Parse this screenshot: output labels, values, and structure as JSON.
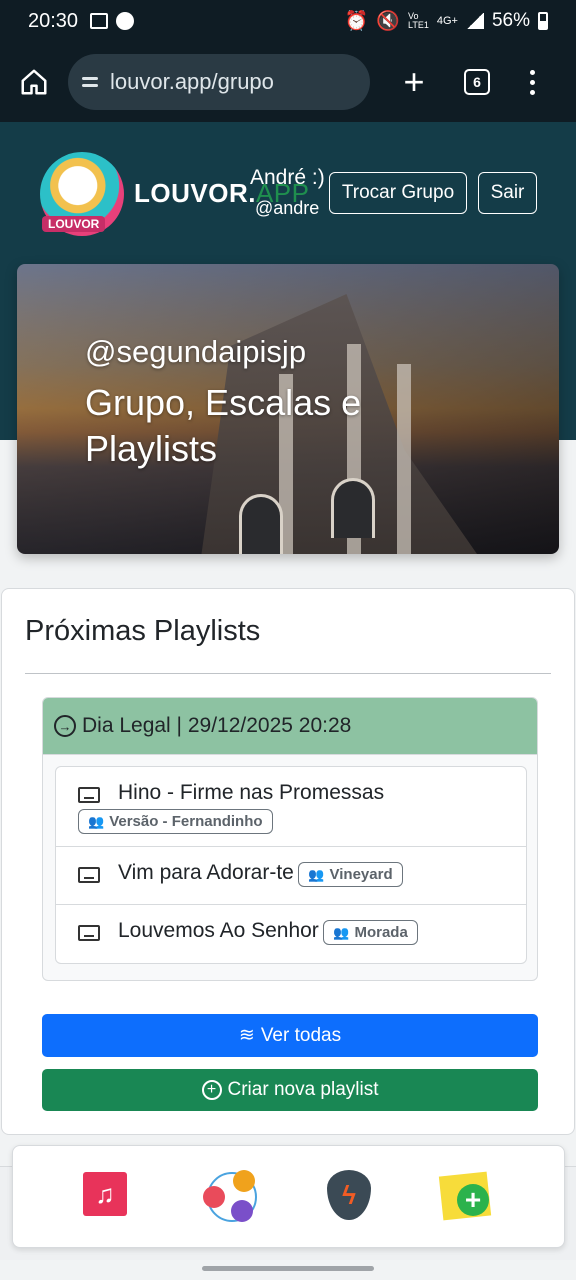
{
  "status_bar": {
    "time": "20:30",
    "network_top": "Vo",
    "network_bottom": "LTE1",
    "data_type": "4G+",
    "battery": "56%"
  },
  "browser": {
    "url": "louvor.app/grupo",
    "tab_count": "6"
  },
  "header": {
    "brand_main": "LOUVOR.",
    "brand_suffix": "APP",
    "logo_text": "LOUVOR",
    "user_name": "André :)",
    "user_handle": "@andre",
    "switch_group_label": "Trocar Grupo",
    "logout_label": "Sair"
  },
  "hero": {
    "group_handle": "@segundaipisjp",
    "title": "Grupo, Escalas e Playlists"
  },
  "card": {
    "title": "Próximas Playlists",
    "playlist": {
      "header": "Dia Legal | 29/12/2025 20:28",
      "songs": [
        {
          "title": "Hino - Firme nas Promessas",
          "version": "Versão - Fernandinho"
        },
        {
          "title": "Vim para Adorar-te",
          "version": "Vineyard"
        },
        {
          "title": "Louvemos Ao Senhor",
          "version": "Morada"
        }
      ]
    },
    "see_all_label": "Ver todas",
    "create_label": "Criar nova playlist"
  },
  "bottom_nav": {
    "items": [
      "music-library-icon",
      "members-icon",
      "pick-icon",
      "add-note-icon"
    ]
  },
  "colors": {
    "header_bg": "#143c48",
    "playlist_header": "#8dc2a2",
    "primary": "#0d6efd",
    "success": "#198754",
    "brand_accent": "#1f8f4e"
  }
}
